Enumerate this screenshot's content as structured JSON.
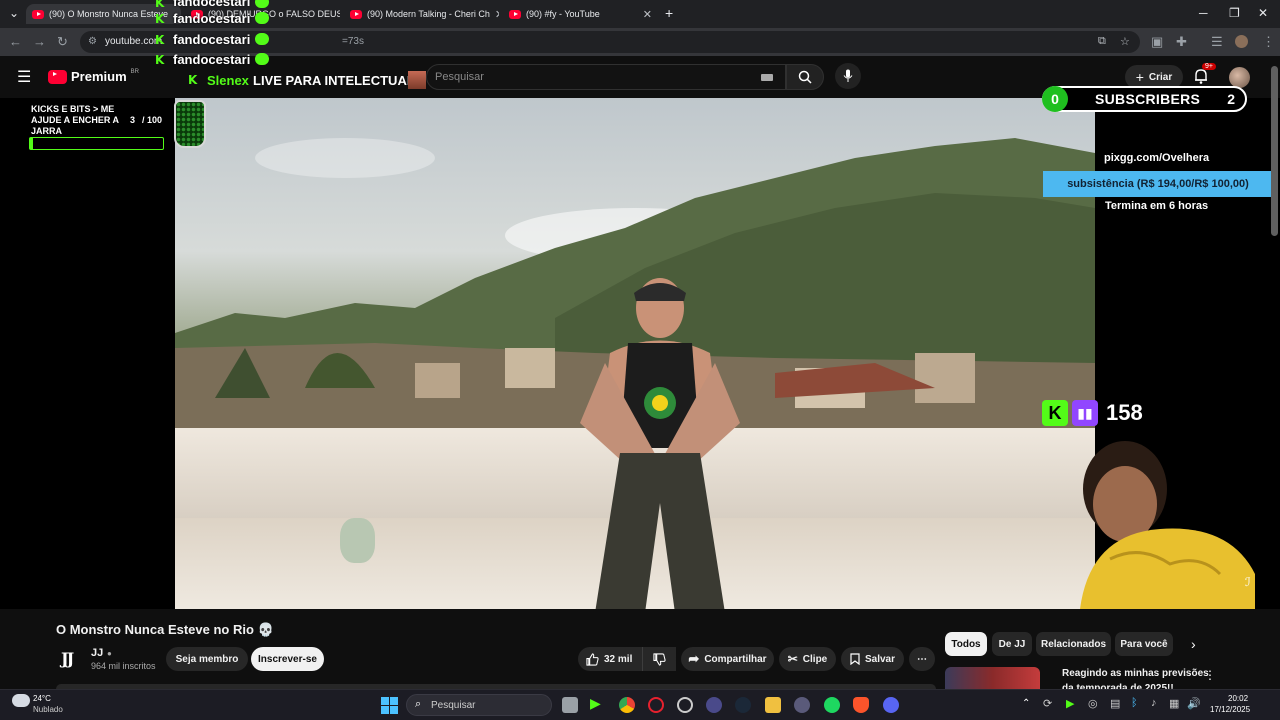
{
  "browser": {
    "tabs": [
      {
        "title": "(90) O Monstro Nunca Esteve"
      },
      {
        "title": "(90) DEMIURGO o FALSO DEUS"
      },
      {
        "title": "(90) Modern Talking - Cheri Ch"
      },
      {
        "title": "(90) #fy - YouTube"
      }
    ],
    "address_prefix": "youtube.com",
    "address_suffix": "=73s"
  },
  "youtube": {
    "logo_text": "Premium",
    "region_badge": "BR",
    "search_placeholder": "Pesquisar",
    "create_label": "Criar",
    "notif_count": "9+"
  },
  "overlay": {
    "chat_names": [
      "fandocestari",
      "fandocestari",
      "fandocestari",
      "fandocestari"
    ],
    "streamer_name": "Slenex",
    "stream_title": "LIVE PARA INTELECTUAIS",
    "goal_label": "KICKS E BITS > ME AJUDE A ENCHER A JARRA",
    "goal_progress": "3",
    "goal_total": "/ 100",
    "subs_left": "0",
    "subs_label": "SUBSCRIBERS",
    "subs_right": "2",
    "pix_url": "pixgg.com/Ovelhera",
    "sub_goal": "subsistência (R$ 194,00/R$ 100,00)",
    "ends_in": "Termina em 6 horas",
    "viewers": "158"
  },
  "video_info": {
    "title": "O Monstro Nunca Esteve no Rio",
    "title_emoji": "💀",
    "channel_logo": "JJ",
    "channel_name": "JJ",
    "subscribers": "964 mil inscritos",
    "join_label": "Seja membro",
    "subscribe_label": "Inscrever-se",
    "likes": "32 mil",
    "share_label": "Compartilhar",
    "clip_label": "Clipe",
    "save_label": "Salvar"
  },
  "related": {
    "chips": [
      "Todos",
      "De JJ",
      "Relacionados",
      "Para você"
    ],
    "first_video_title_line1": "Reagindo as minhas previsões",
    "first_video_title_line2": "da temporada de 2025!!"
  },
  "taskbar": {
    "weather_temp": "24°C",
    "weather_desc": "Nublado",
    "search_placeholder": "Pesquisar",
    "time": "20:02",
    "date": "17/12/2025"
  }
}
